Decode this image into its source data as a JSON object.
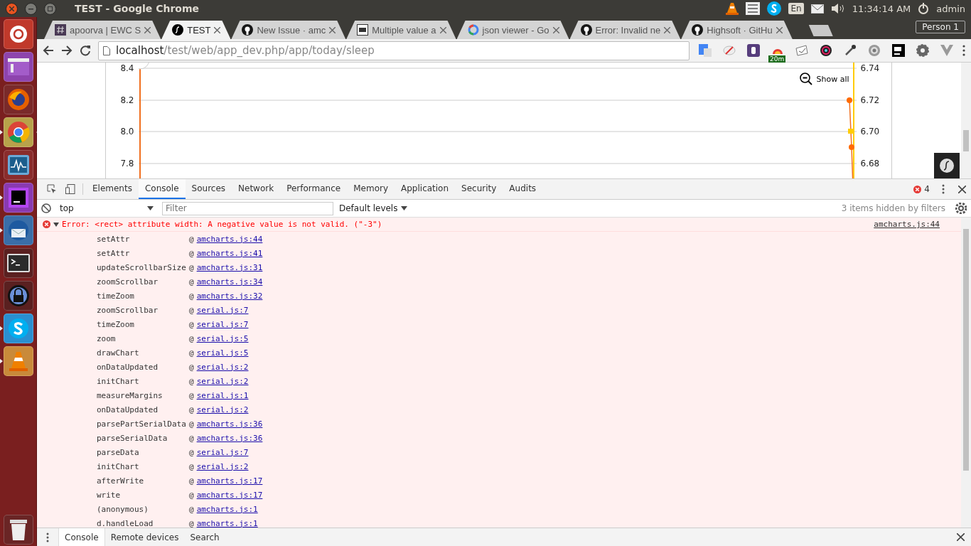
{
  "panel": {
    "title": "TEST - Google Chrome",
    "keyboard": "En",
    "clock": "11:34:14 AM",
    "user": "admin"
  },
  "launcher": [
    {
      "kind": "ubuntu",
      "running": false,
      "focused": false
    },
    {
      "kind": "files",
      "running": false,
      "focused": false
    },
    {
      "kind": "firefox",
      "running": false,
      "focused": false
    },
    {
      "kind": "chrome",
      "running": true,
      "focused": true
    },
    {
      "kind": "monitor",
      "running": false,
      "focused": false
    },
    {
      "kind": "ide",
      "running": true,
      "focused": false
    },
    {
      "kind": "mail",
      "running": true,
      "focused": false
    },
    {
      "kind": "terminal",
      "running": false,
      "focused": false
    },
    {
      "kind": "lock",
      "running": false,
      "focused": false
    },
    {
      "kind": "chat",
      "running": true,
      "focused": false
    },
    {
      "kind": "cone",
      "running": true,
      "focused": false
    }
  ],
  "tabs": [
    {
      "title": "apoorva | EWC S",
      "kind": "hash",
      "selected": false
    },
    {
      "title": "TEST",
      "kind": "symfony",
      "selected": true
    },
    {
      "title": "New Issue · amc",
      "kind": "github",
      "selected": false
    },
    {
      "title": "Multiple value a",
      "kind": "cb",
      "selected": false
    },
    {
      "title": "json viewer - Go",
      "kind": "google",
      "selected": false
    },
    {
      "title": "Error: Invalid ne",
      "kind": "github",
      "selected": false
    },
    {
      "title": "Highsoft · GitHu",
      "kind": "github",
      "selected": false
    }
  ],
  "profile": "Person 1",
  "address": {
    "host": "localhost",
    "path": "/test/web/app_dev.php/app/today/sleep"
  },
  "extensions": [
    {
      "kind": "translate"
    },
    {
      "kind": "pen"
    },
    {
      "kind": "bootstrap"
    },
    {
      "kind": "weather",
      "badge": "20m"
    },
    {
      "kind": "note"
    },
    {
      "kind": "color"
    },
    {
      "kind": "dropper"
    },
    {
      "kind": "gear"
    },
    {
      "kind": "jb"
    },
    {
      "kind": "cog"
    },
    {
      "kind": "vue"
    }
  ],
  "chart": {
    "left_ticks": [
      "8.4",
      "8.2",
      "8.0",
      "7.8"
    ],
    "right_ticks": [
      "6.74",
      "6.72",
      "6.70",
      "6.68"
    ],
    "zoom_button": "Show all"
  },
  "devtools": {
    "tabs": [
      {
        "label": "Elements",
        "selected": false
      },
      {
        "label": "Console",
        "selected": true
      },
      {
        "label": "Sources",
        "selected": false
      },
      {
        "label": "Network",
        "selected": false
      },
      {
        "label": "Performance",
        "selected": false
      },
      {
        "label": "Memory",
        "selected": false
      },
      {
        "label": "Application",
        "selected": false
      },
      {
        "label": "Security",
        "selected": false
      },
      {
        "label": "Audits",
        "selected": false
      }
    ],
    "error_count": "4",
    "context": "top",
    "filter_placeholder": "Filter",
    "levels": "Default levels",
    "hidden_note": "3 items hidden by filters",
    "error": {
      "message": "Error: <rect> attribute width: A negative value is not valid. (\"-3\")",
      "source": "amcharts.js:44",
      "expanded": true,
      "stack": [
        {
          "fn": "setAttr",
          "at": "@",
          "src": "amcharts.js:44"
        },
        {
          "fn": "setAttr",
          "at": "@",
          "src": "amcharts.js:41"
        },
        {
          "fn": "updateScrollbarSize",
          "at": "@",
          "src": "amcharts.js:31"
        },
        {
          "fn": "zoomScrollbar",
          "at": "@",
          "src": "amcharts.js:34"
        },
        {
          "fn": "timeZoom",
          "at": "@",
          "src": "amcharts.js:32"
        },
        {
          "fn": "zoomScrollbar",
          "at": "@",
          "src": "serial.js:7"
        },
        {
          "fn": "timeZoom",
          "at": "@",
          "src": "serial.js:7"
        },
        {
          "fn": "zoom",
          "at": "@",
          "src": "serial.js:5"
        },
        {
          "fn": "drawChart",
          "at": "@",
          "src": "serial.js:5"
        },
        {
          "fn": "onDataUpdated",
          "at": "@",
          "src": "serial.js:2"
        },
        {
          "fn": "initChart",
          "at": "@",
          "src": "serial.js:2"
        },
        {
          "fn": "measureMargins",
          "at": "@",
          "src": "serial.js:1"
        },
        {
          "fn": "onDataUpdated",
          "at": "@",
          "src": "serial.js:2"
        },
        {
          "fn": "parsePartSerialData",
          "at": "@",
          "src": "amcharts.js:36"
        },
        {
          "fn": "parseSerialData",
          "at": "@",
          "src": "amcharts.js:36"
        },
        {
          "fn": "parseData",
          "at": "@",
          "src": "serial.js:7"
        },
        {
          "fn": "initChart",
          "at": "@",
          "src": "serial.js:2"
        },
        {
          "fn": "afterWrite",
          "at": "@",
          "src": "amcharts.js:17"
        },
        {
          "fn": "write",
          "at": "@",
          "src": "amcharts.js:17"
        },
        {
          "fn": "(anonymous)",
          "at": "@",
          "src": "amcharts.js:1"
        },
        {
          "fn": "d.handleLoad",
          "at": "@",
          "src": "amcharts.js:1"
        }
      ]
    },
    "drawer_tabs": [
      {
        "label": "Console",
        "selected": true
      },
      {
        "label": "Remote devices",
        "selected": false
      },
      {
        "label": "Search",
        "selected": false
      }
    ]
  }
}
